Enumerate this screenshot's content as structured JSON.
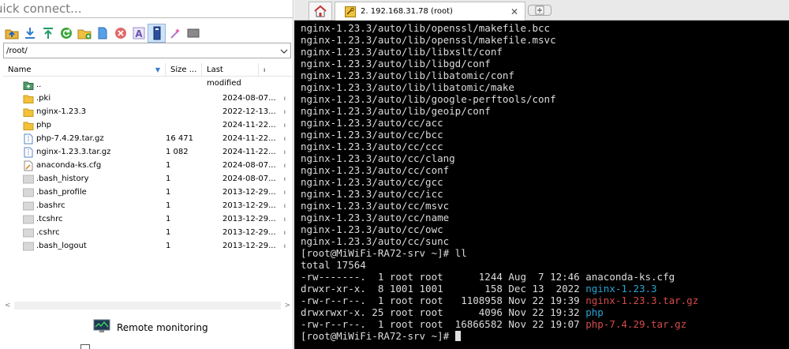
{
  "left_panel": {
    "quick_connect": {
      "value": "uick connect..."
    },
    "toolbar_icons": [
      "folder-up-icon",
      "download-icon",
      "upload-icon",
      "refresh-icon",
      "new-folder-icon",
      "new-file-icon",
      "delete-icon",
      "rename-icon",
      "properties-icon",
      "chmod-icon",
      "terminal-icon"
    ],
    "path": {
      "value": "/root/"
    },
    "columns": {
      "name": "Name",
      "size": "Size ...",
      "modified": "Last modified"
    },
    "files": [
      {
        "name": "..",
        "size": "",
        "date": "",
        "icon": "parent-folder-icon"
      },
      {
        "name": ".pki",
        "size": "",
        "date": "2024-08-07...",
        "icon": "folder-icon"
      },
      {
        "name": "nginx-1.23.3",
        "size": "",
        "date": "2022-12-13...",
        "icon": "folder-icon"
      },
      {
        "name": "php",
        "size": "",
        "date": "2024-11-22...",
        "icon": "folder-icon"
      },
      {
        "name": "php-7.4.29.tar.gz",
        "size": "16 471",
        "date": "2024-11-22...",
        "icon": "archive-file-icon"
      },
      {
        "name": "nginx-1.23.3.tar.gz",
        "size": "1 082",
        "date": "2024-11-22...",
        "icon": "archive-file-icon"
      },
      {
        "name": "anaconda-ks.cfg",
        "size": "1",
        "date": "2024-08-07...",
        "icon": "config-file-icon"
      },
      {
        "name": ".bash_history",
        "size": "1",
        "date": "2024-08-07...",
        "icon": "generic-file-icon"
      },
      {
        "name": ".bash_profile",
        "size": "1",
        "date": "2013-12-29...",
        "icon": "generic-file-icon"
      },
      {
        "name": ".bashrc",
        "size": "1",
        "date": "2013-12-29...",
        "icon": "generic-file-icon"
      },
      {
        "name": ".tcshrc",
        "size": "1",
        "date": "2013-12-29...",
        "icon": "generic-file-icon"
      },
      {
        "name": ".cshrc",
        "size": "1",
        "date": "2013-12-29...",
        "icon": "generic-file-icon"
      },
      {
        "name": ".bash_logout",
        "size": "1",
        "date": "2013-12-29...",
        "icon": "generic-file-icon"
      }
    ],
    "remote_monitoring": "Remote monitoring"
  },
  "terminal": {
    "tab_label": "2. 192.168.31.78 (root)",
    "lines": [
      "nginx-1.23.3/auto/lib/openssl/makefile.bcc",
      "nginx-1.23.3/auto/lib/openssl/makefile.msvc",
      "nginx-1.23.3/auto/lib/libxslt/conf",
      "nginx-1.23.3/auto/lib/libgd/conf",
      "nginx-1.23.3/auto/lib/libatomic/conf",
      "nginx-1.23.3/auto/lib/libatomic/make",
      "nginx-1.23.3/auto/lib/google-perftools/conf",
      "nginx-1.23.3/auto/lib/geoip/conf",
      "nginx-1.23.3/auto/cc/acc",
      "nginx-1.23.3/auto/cc/bcc",
      "nginx-1.23.3/auto/cc/ccc",
      "nginx-1.23.3/auto/cc/clang",
      "nginx-1.23.3/auto/cc/conf",
      "nginx-1.23.3/auto/cc/gcc",
      "nginx-1.23.3/auto/cc/icc",
      "nginx-1.23.3/auto/cc/msvc",
      "nginx-1.23.3/auto/cc/name",
      "nginx-1.23.3/auto/cc/owc",
      "nginx-1.23.3/auto/cc/sunc",
      "[root@MiWiFi-RA72-srv ~]# ll",
      "total 17564"
    ],
    "listing": [
      {
        "meta": "-rw-------.  1 root root      1244 Aug  7 12:46 ",
        "file": "anaconda-ks.cfg",
        "color": "default"
      },
      {
        "meta": "drwxr-xr-x.  8 1001 1001       158 Dec 13  2022 ",
        "file": "nginx-1.23.3",
        "color": "cyan"
      },
      {
        "meta": "-rw-r--r--.  1 root root   1108958 Nov 22 19:39 ",
        "file": "nginx-1.23.3.tar.gz",
        "color": "red"
      },
      {
        "meta": "drwxrwxr-x. 25 root root      4096 Nov 22 19:32 ",
        "file": "php",
        "color": "cyan"
      },
      {
        "meta": "-rw-r--r--.  1 root root  16866582 Nov 22 19:07 ",
        "file": "php-7.4.29.tar.gz",
        "color": "red"
      }
    ],
    "prompt": "[root@MiWiFi-RA72-srv ~]# ",
    "colors": {
      "background": "#000000",
      "text": "#dcdcdc",
      "directory": "#29a4d3",
      "archive": "#d64a4a"
    }
  }
}
